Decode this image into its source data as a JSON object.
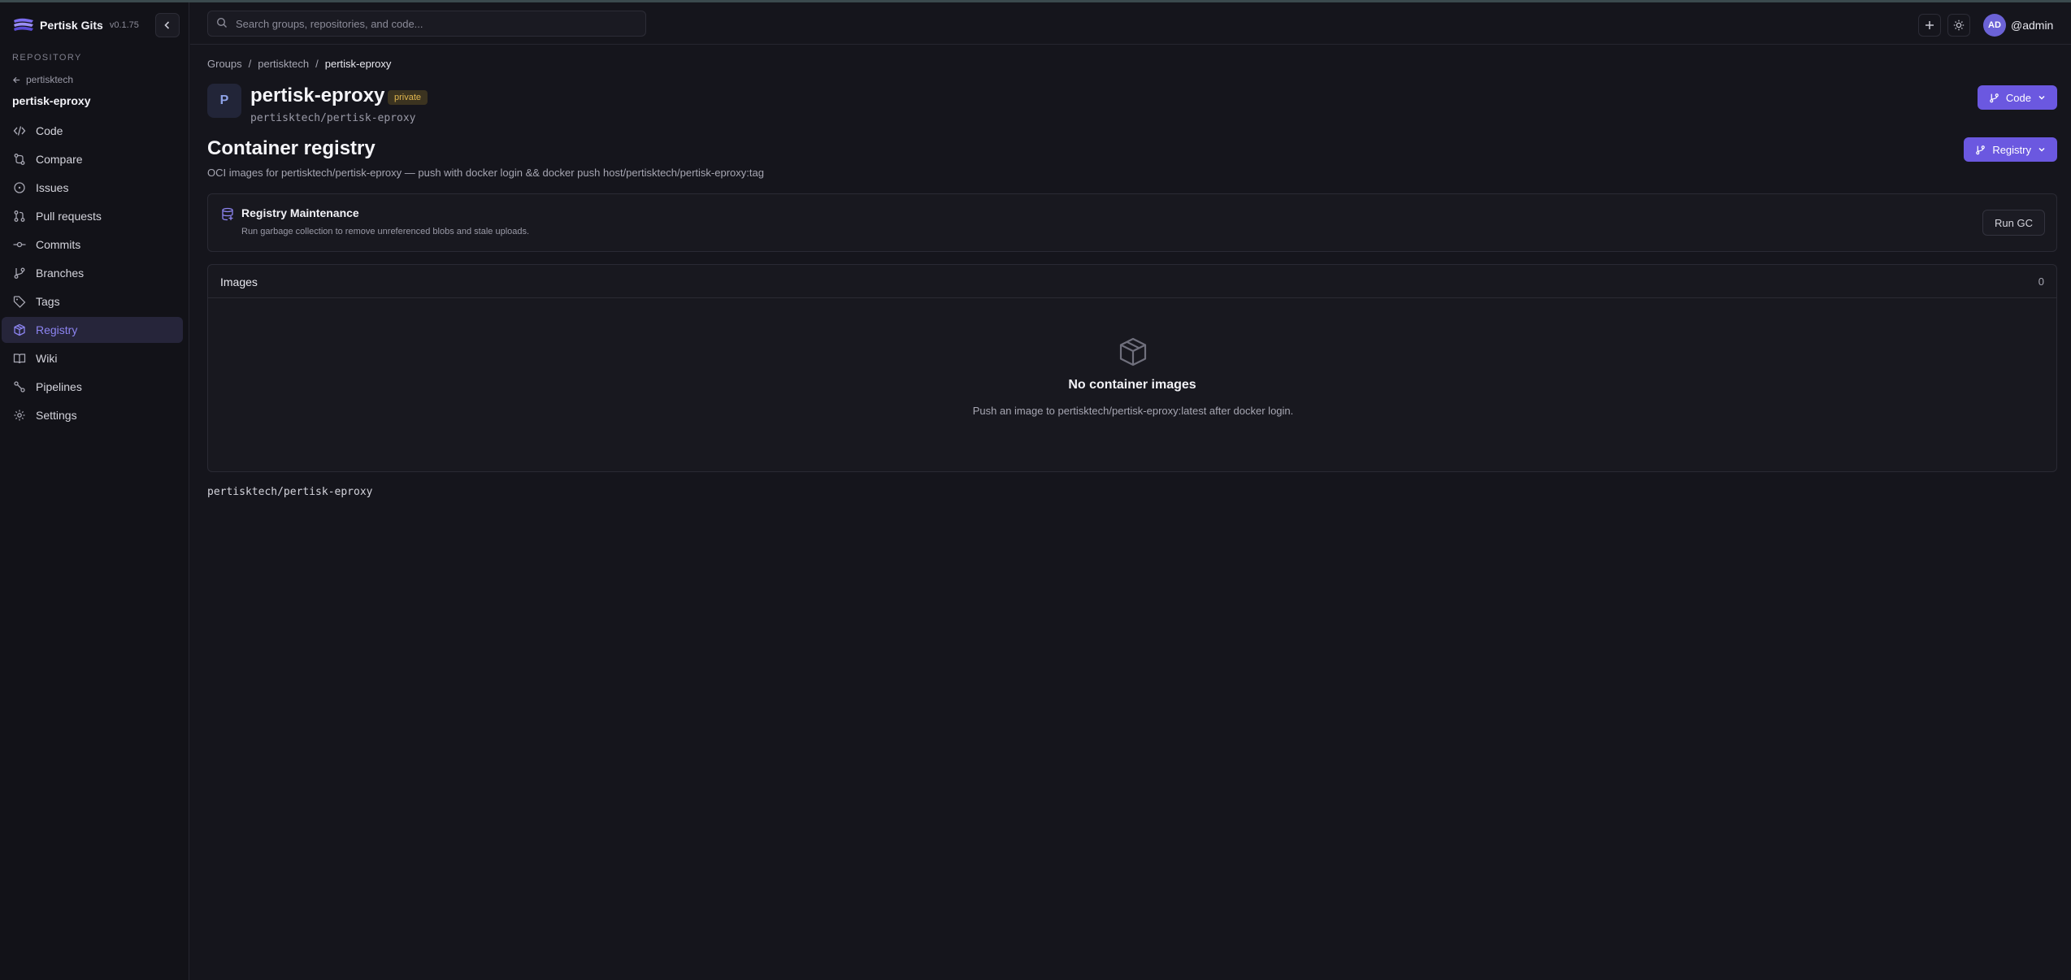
{
  "app": {
    "name": "Pertisk Gits",
    "version": "v0.1.75"
  },
  "sidebar": {
    "section_label": "REPOSITORY",
    "back_label": "pertisktech",
    "repo_name": "pertisk-eproxy",
    "items": [
      {
        "label": "Code",
        "icon": "code-icon"
      },
      {
        "label": "Compare",
        "icon": "compare-icon"
      },
      {
        "label": "Issues",
        "icon": "issue-icon"
      },
      {
        "label": "Pull requests",
        "icon": "pull-request-icon"
      },
      {
        "label": "Commits",
        "icon": "commit-icon"
      },
      {
        "label": "Branches",
        "icon": "branch-icon"
      },
      {
        "label": "Tags",
        "icon": "tag-icon"
      },
      {
        "label": "Registry",
        "icon": "package-icon",
        "active": true
      },
      {
        "label": "Wiki",
        "icon": "book-icon"
      },
      {
        "label": "Pipelines",
        "icon": "pipeline-icon"
      },
      {
        "label": "Settings",
        "icon": "gear-icon"
      }
    ]
  },
  "header": {
    "search_placeholder": "Search groups, repositories, and code...",
    "avatar_initials": "AD",
    "username": "@admin"
  },
  "breadcrumb": [
    "Groups",
    "pertisktech",
    "pertisk-eproxy"
  ],
  "repo": {
    "avatar_letter": "P",
    "title": "pertisk-eproxy",
    "visibility": "private",
    "path": "pertisktech/pertisk-eproxy",
    "code_button": "Code"
  },
  "page": {
    "title": "Container registry",
    "description": "OCI images for pertisktech/pertisk-eproxy — push with docker login && docker push host/pertisktech/pertisk-eproxy:tag",
    "registry_button": "Registry"
  },
  "maintenance": {
    "title": "Registry Maintenance",
    "description": "Run garbage collection to remove unreferenced blobs and stale uploads.",
    "button": "Run GC"
  },
  "images": {
    "title": "Images",
    "count": "0",
    "empty_title": "No container images",
    "empty_desc": "Push an image to pertisktech/pertisk-eproxy:latest after docker login."
  },
  "footer_path": "pertisktech/pertisk-eproxy",
  "colors": {
    "accent": "#6b58e0",
    "active_nav": "#8c84f0",
    "badge": "#e0b64e"
  }
}
